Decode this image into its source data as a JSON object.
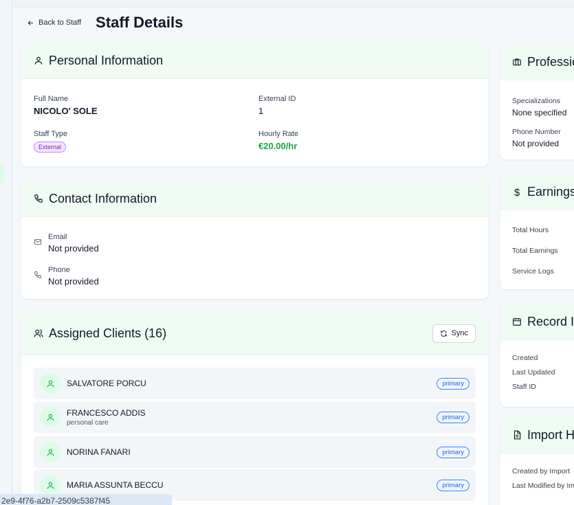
{
  "header": {
    "back_label": "Back to Staff",
    "title": "Staff Details"
  },
  "personal": {
    "title": "Personal Information",
    "full_name_label": "Full Name",
    "full_name": "NICOLO' SOLE",
    "external_id_label": "External ID",
    "external_id": "1",
    "staff_type_label": "Staff Type",
    "staff_type": "External",
    "hourly_rate_label": "Hourly Rate",
    "hourly_rate": "€20.00/hr"
  },
  "contact": {
    "title": "Contact Information",
    "email_label": "Email",
    "email": "Not provided",
    "phone_label": "Phone",
    "phone": "Not provided"
  },
  "clients": {
    "title": "Assigned Clients (16)",
    "sync_label": "Sync",
    "items": [
      {
        "name": "SALVATORE PORCU",
        "sub": "",
        "badge": "primary"
      },
      {
        "name": "FRANCESCO ADDIS",
        "sub": "personal care",
        "badge": "primary"
      },
      {
        "name": "NORINA FANARI",
        "sub": "",
        "badge": "primary"
      },
      {
        "name": "MARIA ASSUNTA BECCU",
        "sub": "",
        "badge": "primary"
      }
    ]
  },
  "professional": {
    "title": "Professio",
    "specializations_label": "Specializations",
    "specializations": "None specified",
    "phone_label": "Phone Number",
    "phone": "Not provided"
  },
  "earnings": {
    "title": "Earnings",
    "total_hours_label": "Total Hours",
    "total_earnings_label": "Total Earnings",
    "service_logs_label": "Service Logs"
  },
  "record": {
    "title": "Record In",
    "created_label": "Created",
    "updated_label": "Last Updated",
    "staff_id_label": "Staff ID"
  },
  "import": {
    "title": "Import H",
    "created_by_label": "Created by Import",
    "modified_by_label": "Last Modified by Im"
  },
  "status_url": "2e9-4f76-a2b7-2509c5387f45"
}
